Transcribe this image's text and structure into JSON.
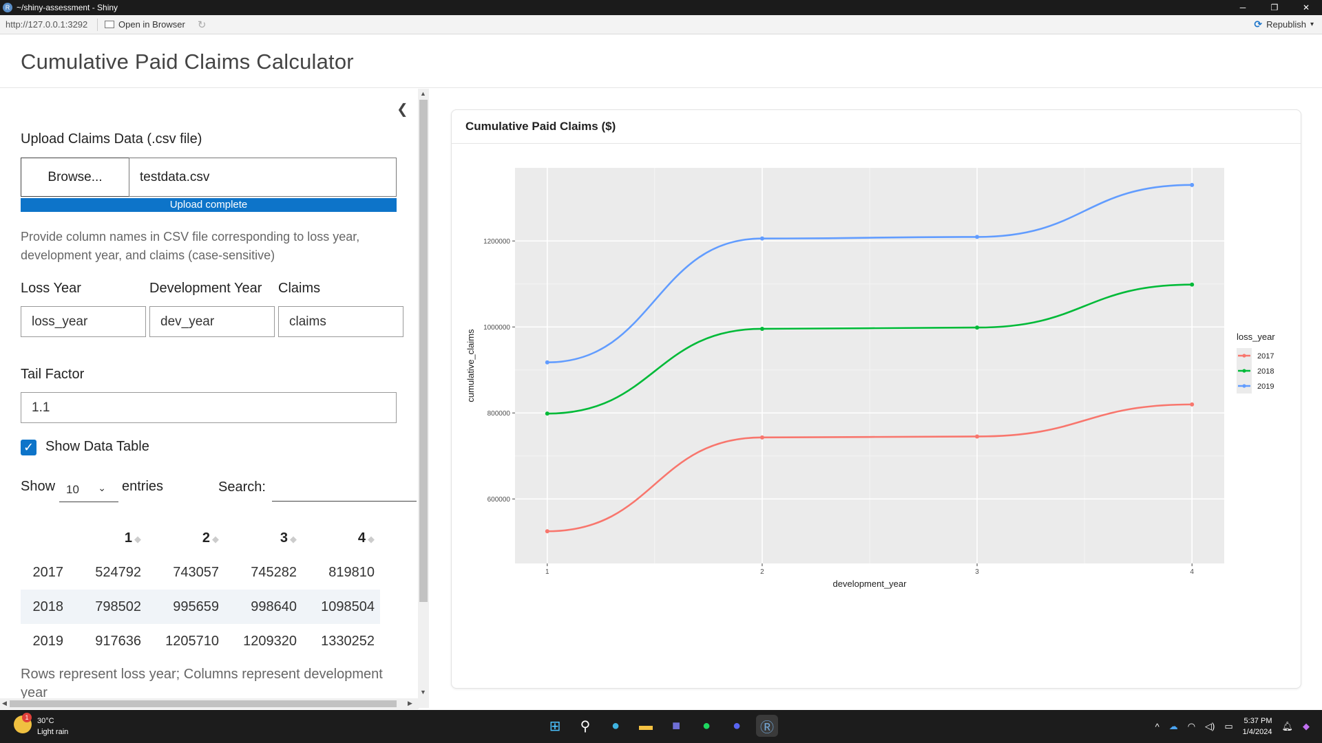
{
  "window": {
    "title": "~/shiny-assessment - Shiny",
    "minimize": "─",
    "restore": "❐",
    "close": "✕"
  },
  "address_bar": {
    "url": "http://127.0.0.1:3292",
    "open_in_browser": "Open in Browser",
    "republish": "Republish"
  },
  "app": {
    "title": "Cumulative Paid Claims Calculator"
  },
  "sidebar": {
    "upload_label": "Upload Claims Data (.csv file)",
    "browse_label": "Browse...",
    "file_name": "testdata.csv",
    "upload_status": "Upload complete",
    "upload_progress": 1.0,
    "help_text": "Provide column names in CSV file corresponding to loss year, development year, and claims (case-sensitive)",
    "loss_year_label": "Loss Year",
    "loss_year_value": "loss_year",
    "dev_year_label": "Development Year",
    "dev_year_value": "dev_year",
    "claims_label": "Claims",
    "claims_value": "claims",
    "tail_factor_label": "Tail Factor",
    "tail_factor_value": "1.1",
    "show_table_label": "Show Data Table",
    "show_table_checked": true,
    "show_label": "Show",
    "entries_value": "10",
    "entries_label": "entries",
    "search_label": "Search:",
    "table": {
      "headers": [
        "",
        "1",
        "2",
        "3",
        "4"
      ],
      "rows": [
        [
          "2017",
          "524792",
          "743057",
          "745282",
          "819810"
        ],
        [
          "2018",
          "798502",
          "995659",
          "998640",
          "1098504"
        ],
        [
          "2019",
          "917636",
          "1205710",
          "1209320",
          "1330252"
        ]
      ]
    },
    "footnote": "Rows represent loss year; Columns represent development year"
  },
  "card": {
    "title": "Cumulative Paid Claims ($)"
  },
  "chart_data": {
    "type": "line",
    "x": [
      1,
      2,
      3,
      4
    ],
    "xlabel": "development_year",
    "ylabel": "cumulative_claims",
    "xlim": [
      0.85,
      4.15
    ],
    "ylim": [
      450000,
      1370000
    ],
    "yticks": [
      600000,
      800000,
      1000000,
      1200000
    ],
    "ytick_labels": [
      "600000",
      "800000",
      "1000000",
      "1200000"
    ],
    "legend_title": "loss_year",
    "legend_position": "right",
    "grid": true,
    "series": [
      {
        "name": "2017",
        "color": "#f8766d",
        "values": [
          524792,
          743057,
          745282,
          819810
        ]
      },
      {
        "name": "2018",
        "color": "#00ba38",
        "values": [
          798502,
          995659,
          998640,
          1098504
        ]
      },
      {
        "name": "2019",
        "color": "#619cff",
        "values": [
          917636,
          1205710,
          1209320,
          1330252
        ]
      }
    ]
  },
  "taskbar": {
    "temperature": "30°C",
    "weather": "Light rain",
    "weather_badge": "1",
    "time": "5:37 PM",
    "date": "1/4/2024"
  }
}
